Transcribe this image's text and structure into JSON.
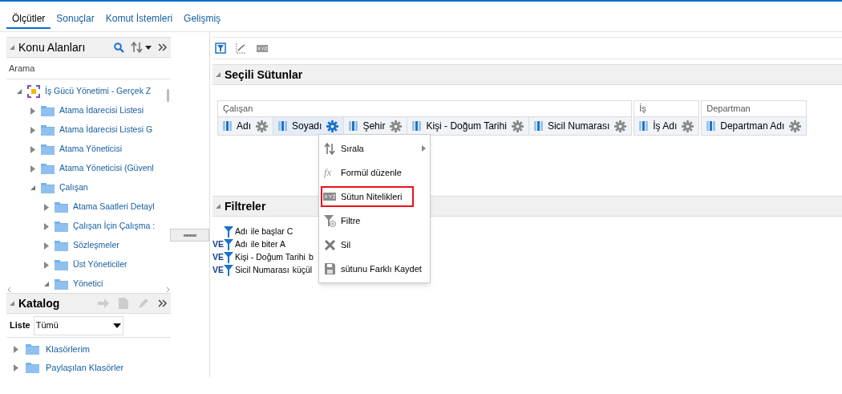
{
  "tabs": [
    {
      "label": "Ölçütler",
      "selected": true
    },
    {
      "label": "Sonuçlar",
      "selected": false
    },
    {
      "label": "Komut İstemleri",
      "selected": false
    },
    {
      "label": "Gelişmiş",
      "selected": false
    }
  ],
  "subject_areas": {
    "title": "Konu Alanları",
    "search_label": "Arama",
    "expanded": true,
    "tree": [
      {
        "label": "İş Gücü Yönetimi - Gerçek Z",
        "kind": "area",
        "expanded": true,
        "children": [
          {
            "label": "Atama İdarecisi Listesi",
            "kind": "folder",
            "expanded": false
          },
          {
            "label": "Atama İdarecisi Listesi G",
            "kind": "folder",
            "expanded": false
          },
          {
            "label": "Atama Yöneticisi",
            "kind": "folder",
            "expanded": false
          },
          {
            "label": "Atama Yöneticisi (Güvenl",
            "kind": "folder",
            "expanded": false
          },
          {
            "label": "Çalışan",
            "kind": "folder",
            "expanded": true,
            "children": [
              {
                "label": "Atama Saatleri Detayl",
                "kind": "folder",
                "expanded": false
              },
              {
                "label": "Çalışan İçin Çalışma :",
                "kind": "folder",
                "expanded": false
              },
              {
                "label": "Sözleşmeler",
                "kind": "folder",
                "expanded": false
              },
              {
                "label": "Üst Yöneticiler",
                "kind": "folder",
                "expanded": false
              },
              {
                "label": "Yönetici",
                "kind": "folder",
                "expanded": true
              }
            ]
          }
        ]
      }
    ]
  },
  "catalog": {
    "title": "Katalog",
    "expanded": true,
    "list_label": "Liste",
    "list_value": "Tümü",
    "tree": [
      {
        "label": "Klasörlerim",
        "kind": "folder",
        "expanded": false
      },
      {
        "label": "Paylaşılan Klasörler",
        "kind": "folder",
        "expanded": false
      }
    ]
  },
  "splitter": {
    "label": "‹‹‹‹‹‹‹‹‹‹‹‹"
  },
  "selected_columns": {
    "title": "Seçili Sütunlar",
    "expanded": true,
    "groups": [
      {
        "name": "Çalışan",
        "columns": [
          {
            "name": "Adı",
            "selected": false
          },
          {
            "name": "Soyadı",
            "selected": true
          },
          {
            "name": "Şehir",
            "selected": false
          },
          {
            "name": "Kişi - Doğum Tarihi",
            "selected": false
          },
          {
            "name": "Sicil Numarası",
            "selected": false
          }
        ]
      },
      {
        "name": "İş",
        "columns": [
          {
            "name": "İş Adı",
            "selected": false
          }
        ]
      },
      {
        "name": "Departman",
        "columns": [
          {
            "name": "Departman Adı",
            "selected": false
          }
        ]
      }
    ]
  },
  "filters": {
    "title": "Filtreler",
    "expanded": true,
    "items": [
      {
        "column": "Adı",
        "condition": "ile başlar C"
      },
      {
        "connector": "VE",
        "column": "Adı",
        "condition": "ile biter A"
      },
      {
        "connector": "VE",
        "column": "Kişi - Doğum Tarihi",
        "condition": "b"
      },
      {
        "connector": "VE",
        "column": "Sicil Numarası",
        "condition": "küçül"
      }
    ]
  },
  "context_menu": {
    "items": [
      {
        "label": "Sırala",
        "kind": "sort",
        "has_submenu": true,
        "highlighted": false
      },
      {
        "label": "Formül düzenle",
        "kind": "formula",
        "icon_text": "fx",
        "has_submenu": false,
        "highlighted": false
      },
      {
        "label": "Sütun Nitelikleri",
        "kind": "properties",
        "has_submenu": false,
        "highlighted": true
      },
      {
        "label": "Filtre",
        "kind": "filter",
        "has_submenu": false,
        "highlighted": false
      },
      {
        "label": "Sil",
        "kind": "delete",
        "has_submenu": false,
        "highlighted": false
      },
      {
        "label": "sütunu Farklı Kaydet",
        "kind": "save",
        "has_submenu": false,
        "highlighted": false
      }
    ]
  }
}
